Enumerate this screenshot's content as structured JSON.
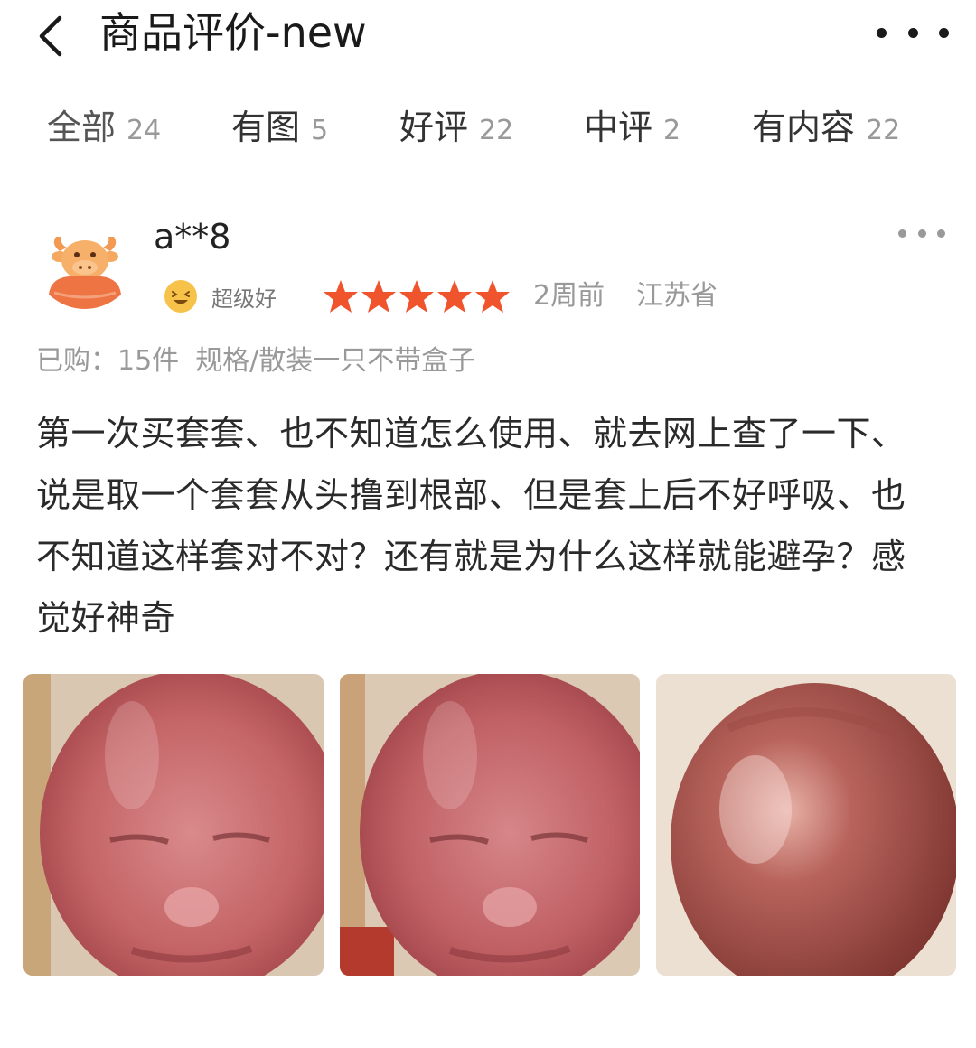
{
  "header": {
    "title": "商品评价-new",
    "back_icon": "chevron-left-icon",
    "more_icon": "more-horizontal-icon"
  },
  "tabs": [
    {
      "label": "全部",
      "count": "24",
      "active": true
    },
    {
      "label": "有图",
      "count": "5"
    },
    {
      "label": "好评",
      "count": "22"
    },
    {
      "label": "中评",
      "count": "2"
    },
    {
      "label": "有内容",
      "count": "22"
    }
  ],
  "review": {
    "username": "a**8",
    "avatar_icon": "cartoon-cow-avatar",
    "badge_label": "超级好",
    "badge_icon": "smiling-face-icon",
    "stars": 5,
    "stars_max": 5,
    "time": "2周前",
    "region": "江苏省",
    "purchased": "已购：15件",
    "spec": "规格/散装一只不带盒子",
    "text": "第一次买套套、也不知道怎么使用、就去网上查了一下、说是取一个套套从头撸到根部、但是套上后不好呼吸、也不知道这样套对不对？还有就是为什么这样就能避孕？感觉好神奇",
    "photos": [
      {
        "subject": "face-in-balloon-photo"
      },
      {
        "subject": "face-in-balloon-photo"
      },
      {
        "subject": "head-top-in-balloon-photo"
      }
    ]
  },
  "colors": {
    "star": "#f0542d",
    "accent": "#f0542d",
    "text_primary": "#2a2a2a",
    "text_secondary": "#999999"
  }
}
